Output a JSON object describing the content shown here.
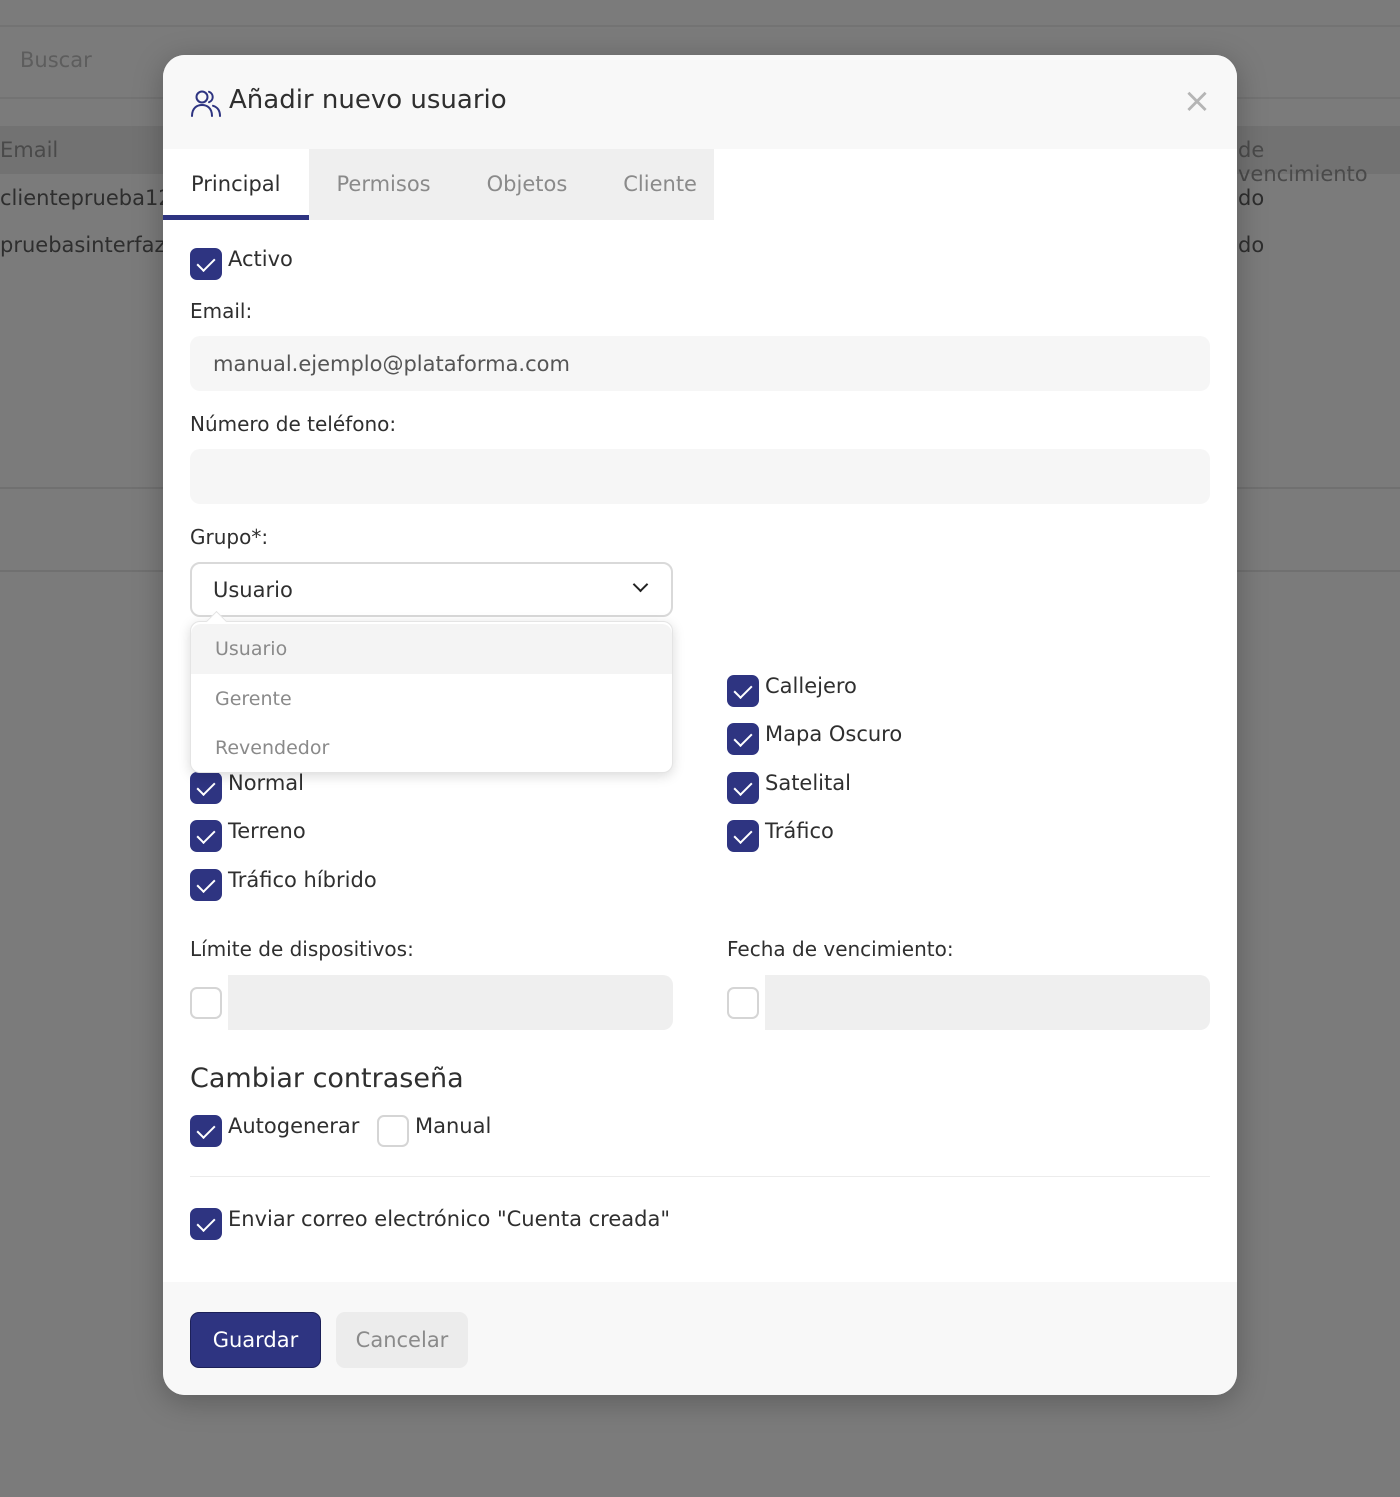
{
  "background": {
    "search_placeholder": "Buscar",
    "columns": {
      "email": "Email",
      "expiry": "de vencimiento"
    },
    "rows": [
      {
        "email": "clienteprueba12",
        "expiry": "do"
      },
      {
        "email": "pruebasinterfaz",
        "expiry": "do"
      }
    ]
  },
  "modal": {
    "title": "Añadir nuevo usuario",
    "close_symbol": "×",
    "tabs": [
      {
        "label": "Principal",
        "active": true
      },
      {
        "label": "Permisos",
        "active": false
      },
      {
        "label": "Objetos",
        "active": false
      },
      {
        "label": "Cliente",
        "active": false
      }
    ],
    "active": {
      "label": "Activo",
      "checked": true
    },
    "email": {
      "label": "Email:",
      "value": "manual.ejemplo@plataforma.com"
    },
    "phone": {
      "label": "Número de teléfono:",
      "value": ""
    },
    "group": {
      "label": "Grupo*:",
      "selected": "Usuario",
      "options": [
        "Usuario",
        "Gerente",
        "Revendedor"
      ]
    },
    "maps_left": [
      {
        "label": "Normal",
        "checked": true
      },
      {
        "label": "Terreno",
        "checked": true
      },
      {
        "label": "Tráfico híbrido",
        "checked": true
      }
    ],
    "maps_right": [
      {
        "label": "Callejero",
        "checked": true
      },
      {
        "label": "Mapa Oscuro",
        "checked": true
      },
      {
        "label": "Satelital",
        "checked": true
      },
      {
        "label": "Tráfico",
        "checked": true
      }
    ],
    "device_limit": {
      "label": "Límite de dispositivos:",
      "checked": false,
      "value": ""
    },
    "expiry_date": {
      "label": "Fecha de vencimiento:",
      "checked": false,
      "value": ""
    },
    "password": {
      "title": "Cambiar contraseña",
      "autogenerate": {
        "label": "Autogenerar",
        "checked": true
      },
      "manual": {
        "label": "Manual",
        "checked": false
      }
    },
    "send_email": {
      "label": "Enviar correo electrónico \"Cuenta creada\"",
      "checked": true
    },
    "footer": {
      "save_label": "Guardar",
      "cancel_label": "Cancelar"
    }
  },
  "colors": {
    "accent": "#2e3481",
    "overlay": "#7b7b7b"
  }
}
